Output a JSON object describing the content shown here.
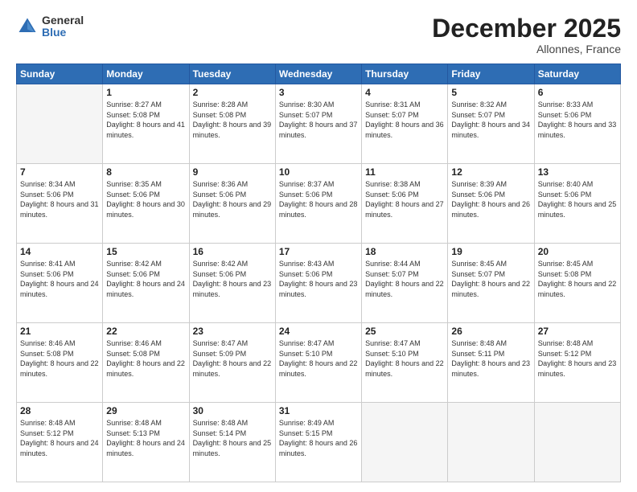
{
  "logo": {
    "general": "General",
    "blue": "Blue"
  },
  "header": {
    "month": "December 2025",
    "location": "Allonnes, France"
  },
  "weekdays": [
    "Sunday",
    "Monday",
    "Tuesday",
    "Wednesday",
    "Thursday",
    "Friday",
    "Saturday"
  ],
  "weeks": [
    [
      {
        "day": "",
        "sunrise": "",
        "sunset": "",
        "daylight": ""
      },
      {
        "day": "1",
        "sunrise": "Sunrise: 8:27 AM",
        "sunset": "Sunset: 5:08 PM",
        "daylight": "Daylight: 8 hours and 41 minutes."
      },
      {
        "day": "2",
        "sunrise": "Sunrise: 8:28 AM",
        "sunset": "Sunset: 5:08 PM",
        "daylight": "Daylight: 8 hours and 39 minutes."
      },
      {
        "day": "3",
        "sunrise": "Sunrise: 8:30 AM",
        "sunset": "Sunset: 5:07 PM",
        "daylight": "Daylight: 8 hours and 37 minutes."
      },
      {
        "day": "4",
        "sunrise": "Sunrise: 8:31 AM",
        "sunset": "Sunset: 5:07 PM",
        "daylight": "Daylight: 8 hours and 36 minutes."
      },
      {
        "day": "5",
        "sunrise": "Sunrise: 8:32 AM",
        "sunset": "Sunset: 5:07 PM",
        "daylight": "Daylight: 8 hours and 34 minutes."
      },
      {
        "day": "6",
        "sunrise": "Sunrise: 8:33 AM",
        "sunset": "Sunset: 5:06 PM",
        "daylight": "Daylight: 8 hours and 33 minutes."
      }
    ],
    [
      {
        "day": "7",
        "sunrise": "Sunrise: 8:34 AM",
        "sunset": "Sunset: 5:06 PM",
        "daylight": "Daylight: 8 hours and 31 minutes."
      },
      {
        "day": "8",
        "sunrise": "Sunrise: 8:35 AM",
        "sunset": "Sunset: 5:06 PM",
        "daylight": "Daylight: 8 hours and 30 minutes."
      },
      {
        "day": "9",
        "sunrise": "Sunrise: 8:36 AM",
        "sunset": "Sunset: 5:06 PM",
        "daylight": "Daylight: 8 hours and 29 minutes."
      },
      {
        "day": "10",
        "sunrise": "Sunrise: 8:37 AM",
        "sunset": "Sunset: 5:06 PM",
        "daylight": "Daylight: 8 hours and 28 minutes."
      },
      {
        "day": "11",
        "sunrise": "Sunrise: 8:38 AM",
        "sunset": "Sunset: 5:06 PM",
        "daylight": "Daylight: 8 hours and 27 minutes."
      },
      {
        "day": "12",
        "sunrise": "Sunrise: 8:39 AM",
        "sunset": "Sunset: 5:06 PM",
        "daylight": "Daylight: 8 hours and 26 minutes."
      },
      {
        "day": "13",
        "sunrise": "Sunrise: 8:40 AM",
        "sunset": "Sunset: 5:06 PM",
        "daylight": "Daylight: 8 hours and 25 minutes."
      }
    ],
    [
      {
        "day": "14",
        "sunrise": "Sunrise: 8:41 AM",
        "sunset": "Sunset: 5:06 PM",
        "daylight": "Daylight: 8 hours and 24 minutes."
      },
      {
        "day": "15",
        "sunrise": "Sunrise: 8:42 AM",
        "sunset": "Sunset: 5:06 PM",
        "daylight": "Daylight: 8 hours and 24 minutes."
      },
      {
        "day": "16",
        "sunrise": "Sunrise: 8:42 AM",
        "sunset": "Sunset: 5:06 PM",
        "daylight": "Daylight: 8 hours and 23 minutes."
      },
      {
        "day": "17",
        "sunrise": "Sunrise: 8:43 AM",
        "sunset": "Sunset: 5:06 PM",
        "daylight": "Daylight: 8 hours and 23 minutes."
      },
      {
        "day": "18",
        "sunrise": "Sunrise: 8:44 AM",
        "sunset": "Sunset: 5:07 PM",
        "daylight": "Daylight: 8 hours and 22 minutes."
      },
      {
        "day": "19",
        "sunrise": "Sunrise: 8:45 AM",
        "sunset": "Sunset: 5:07 PM",
        "daylight": "Daylight: 8 hours and 22 minutes."
      },
      {
        "day": "20",
        "sunrise": "Sunrise: 8:45 AM",
        "sunset": "Sunset: 5:08 PM",
        "daylight": "Daylight: 8 hours and 22 minutes."
      }
    ],
    [
      {
        "day": "21",
        "sunrise": "Sunrise: 8:46 AM",
        "sunset": "Sunset: 5:08 PM",
        "daylight": "Daylight: 8 hours and 22 minutes."
      },
      {
        "day": "22",
        "sunrise": "Sunrise: 8:46 AM",
        "sunset": "Sunset: 5:08 PM",
        "daylight": "Daylight: 8 hours and 22 minutes."
      },
      {
        "day": "23",
        "sunrise": "Sunrise: 8:47 AM",
        "sunset": "Sunset: 5:09 PM",
        "daylight": "Daylight: 8 hours and 22 minutes."
      },
      {
        "day": "24",
        "sunrise": "Sunrise: 8:47 AM",
        "sunset": "Sunset: 5:10 PM",
        "daylight": "Daylight: 8 hours and 22 minutes."
      },
      {
        "day": "25",
        "sunrise": "Sunrise: 8:47 AM",
        "sunset": "Sunset: 5:10 PM",
        "daylight": "Daylight: 8 hours and 22 minutes."
      },
      {
        "day": "26",
        "sunrise": "Sunrise: 8:48 AM",
        "sunset": "Sunset: 5:11 PM",
        "daylight": "Daylight: 8 hours and 23 minutes."
      },
      {
        "day": "27",
        "sunrise": "Sunrise: 8:48 AM",
        "sunset": "Sunset: 5:12 PM",
        "daylight": "Daylight: 8 hours and 23 minutes."
      }
    ],
    [
      {
        "day": "28",
        "sunrise": "Sunrise: 8:48 AM",
        "sunset": "Sunset: 5:12 PM",
        "daylight": "Daylight: 8 hours and 24 minutes."
      },
      {
        "day": "29",
        "sunrise": "Sunrise: 8:48 AM",
        "sunset": "Sunset: 5:13 PM",
        "daylight": "Daylight: 8 hours and 24 minutes."
      },
      {
        "day": "30",
        "sunrise": "Sunrise: 8:48 AM",
        "sunset": "Sunset: 5:14 PM",
        "daylight": "Daylight: 8 hours and 25 minutes."
      },
      {
        "day": "31",
        "sunrise": "Sunrise: 8:49 AM",
        "sunset": "Sunset: 5:15 PM",
        "daylight": "Daylight: 8 hours and 26 minutes."
      },
      {
        "day": "",
        "sunrise": "",
        "sunset": "",
        "daylight": ""
      },
      {
        "day": "",
        "sunrise": "",
        "sunset": "",
        "daylight": ""
      },
      {
        "day": "",
        "sunrise": "",
        "sunset": "",
        "daylight": ""
      }
    ]
  ]
}
